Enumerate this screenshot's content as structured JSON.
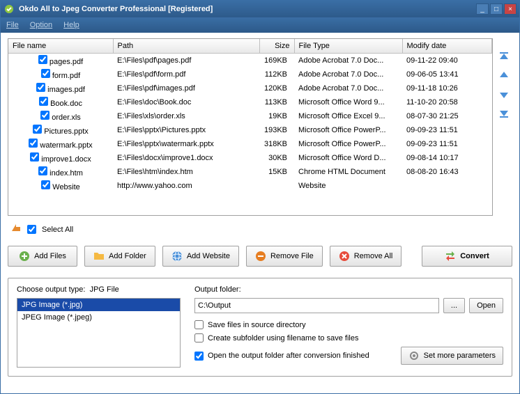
{
  "window": {
    "title": "Okdo All to Jpeg Converter Professional [Registered]"
  },
  "menu": {
    "file": "File",
    "option": "Option",
    "help": "Help"
  },
  "grid": {
    "headers": {
      "filename": "File name",
      "path": "Path",
      "size": "Size",
      "filetype": "File Type",
      "modify": "Modify date"
    },
    "rows": [
      {
        "name": "pages.pdf",
        "path": "E:\\Files\\pdf\\pages.pdf",
        "size": "169KB",
        "type": "Adobe Acrobat 7.0 Doc...",
        "date": "09-11-22 09:40"
      },
      {
        "name": "form.pdf",
        "path": "E:\\Files\\pdf\\form.pdf",
        "size": "112KB",
        "type": "Adobe Acrobat 7.0 Doc...",
        "date": "09-06-05 13:41"
      },
      {
        "name": "images.pdf",
        "path": "E:\\Files\\pdf\\images.pdf",
        "size": "120KB",
        "type": "Adobe Acrobat 7.0 Doc...",
        "date": "09-11-18 10:26"
      },
      {
        "name": "Book.doc",
        "path": "E:\\Files\\doc\\Book.doc",
        "size": "113KB",
        "type": "Microsoft Office Word 9...",
        "date": "11-10-20 20:58"
      },
      {
        "name": "order.xls",
        "path": "E:\\Files\\xls\\order.xls",
        "size": "19KB",
        "type": "Microsoft Office Excel 9...",
        "date": "08-07-30 21:25"
      },
      {
        "name": "Pictures.pptx",
        "path": "E:\\Files\\pptx\\Pictures.pptx",
        "size": "193KB",
        "type": "Microsoft Office PowerP...",
        "date": "09-09-23 11:51"
      },
      {
        "name": "watermark.pptx",
        "path": "E:\\Files\\pptx\\watermark.pptx",
        "size": "318KB",
        "type": "Microsoft Office PowerP...",
        "date": "09-09-23 11:51"
      },
      {
        "name": "improve1.docx",
        "path": "E:\\Files\\docx\\improve1.docx",
        "size": "30KB",
        "type": "Microsoft Office Word D...",
        "date": "09-08-14 10:17"
      },
      {
        "name": "index.htm",
        "path": "E:\\Files\\htm\\index.htm",
        "size": "15KB",
        "type": "Chrome HTML Document",
        "date": "08-08-20 16:43"
      },
      {
        "name": "Website",
        "path": "http://www.yahoo.com",
        "size": "",
        "type": "Website",
        "date": ""
      }
    ]
  },
  "selectall": "Select All",
  "buttons": {
    "addfiles": "Add Files",
    "addfolder": "Add Folder",
    "addwebsite": "Add Website",
    "removefile": "Remove File",
    "removeall": "Remove All",
    "convert": "Convert"
  },
  "output": {
    "type_label": "Choose output type:",
    "type_value": "JPG File",
    "types": [
      {
        "label": "JPG Image (*.jpg)",
        "selected": true
      },
      {
        "label": "JPEG Image (*.jpeg)",
        "selected": false
      }
    ],
    "folder_label": "Output folder:",
    "folder_value": "C:\\Output",
    "browse": "...",
    "open": "Open",
    "save_source": "Save files in source directory",
    "create_subfolder": "Create subfolder using filename to save files",
    "open_after": "Open the output folder after conversion finished",
    "more_params": "Set more parameters"
  }
}
